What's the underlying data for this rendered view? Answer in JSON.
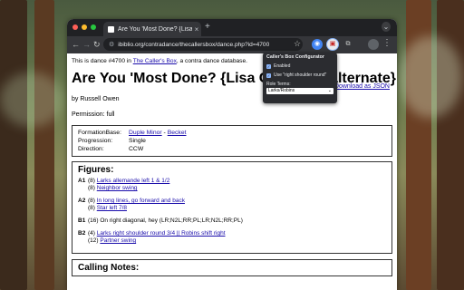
{
  "browser": {
    "tab_title": "Are You 'Most Done? {Lisa G",
    "url": "ibiblio.org/contradance/thecallersbox/dance.php?id=4700",
    "new_tab_symbol": "+"
  },
  "page": {
    "intro_prefix": "This is dance #4700 in ",
    "intro_link": "The Caller's Box",
    "intro_suffix": ", a contra dance database.",
    "json_link": "Download as JSON",
    "title": "Are You 'Most Done? {Lisa Greenleaf alternate}",
    "author": "by Russell Owen",
    "permission": "Permission: full",
    "info": [
      {
        "key": "FormationBase:",
        "value_link1": "Duple Minor",
        "sep": " - ",
        "value_link2": "Becket"
      },
      {
        "key": "Progression:",
        "value": "Single"
      },
      {
        "key": "Direction:",
        "value": "CCW"
      }
    ],
    "figures_heading": "Figures:",
    "figures": [
      {
        "label": "A1",
        "lines": [
          [
            "(8) ",
            "Larks allemande left 1 & 1/2"
          ],
          [
            "(8) ",
            "Neighbor swing"
          ]
        ]
      },
      {
        "label": "A2",
        "lines": [
          [
            "(8) ",
            "In long lines, go forward and back"
          ],
          [
            "(8) ",
            "Star left 7/8"
          ]
        ]
      },
      {
        "label": "B1",
        "lines": [
          [
            "(16) ",
            "On right diagonal, hey (LR;N2L;RR;PL;LR;N2L;RR;PL)"
          ]
        ]
      },
      {
        "label": "B2",
        "lines": [
          [
            "(4) ",
            "Larks right shoulder round 3/4 || Robins shift right"
          ],
          [
            "(12) ",
            "Partner swing"
          ]
        ]
      }
    ],
    "notes_heading": "Calling Notes:"
  },
  "popup": {
    "title": "Caller's Box Configurator",
    "option1": "Enabled",
    "option2": "Use \"right shoulder round\"",
    "role_label": "Role Terms:",
    "role_value": "Larks/Robins"
  },
  "colors": {
    "traffic_red": "#ff5f57",
    "traffic_yellow": "#febc2e",
    "traffic_green": "#28c840",
    "link": "#1a0dab",
    "accent": "#8ab4f8"
  },
  "icons": [
    "back-arrow-icon",
    "forward-arrow-icon",
    "reload-icon",
    "site-info-icon",
    "star-icon",
    "extension-icon",
    "puzzle-icon",
    "more-icon"
  ]
}
